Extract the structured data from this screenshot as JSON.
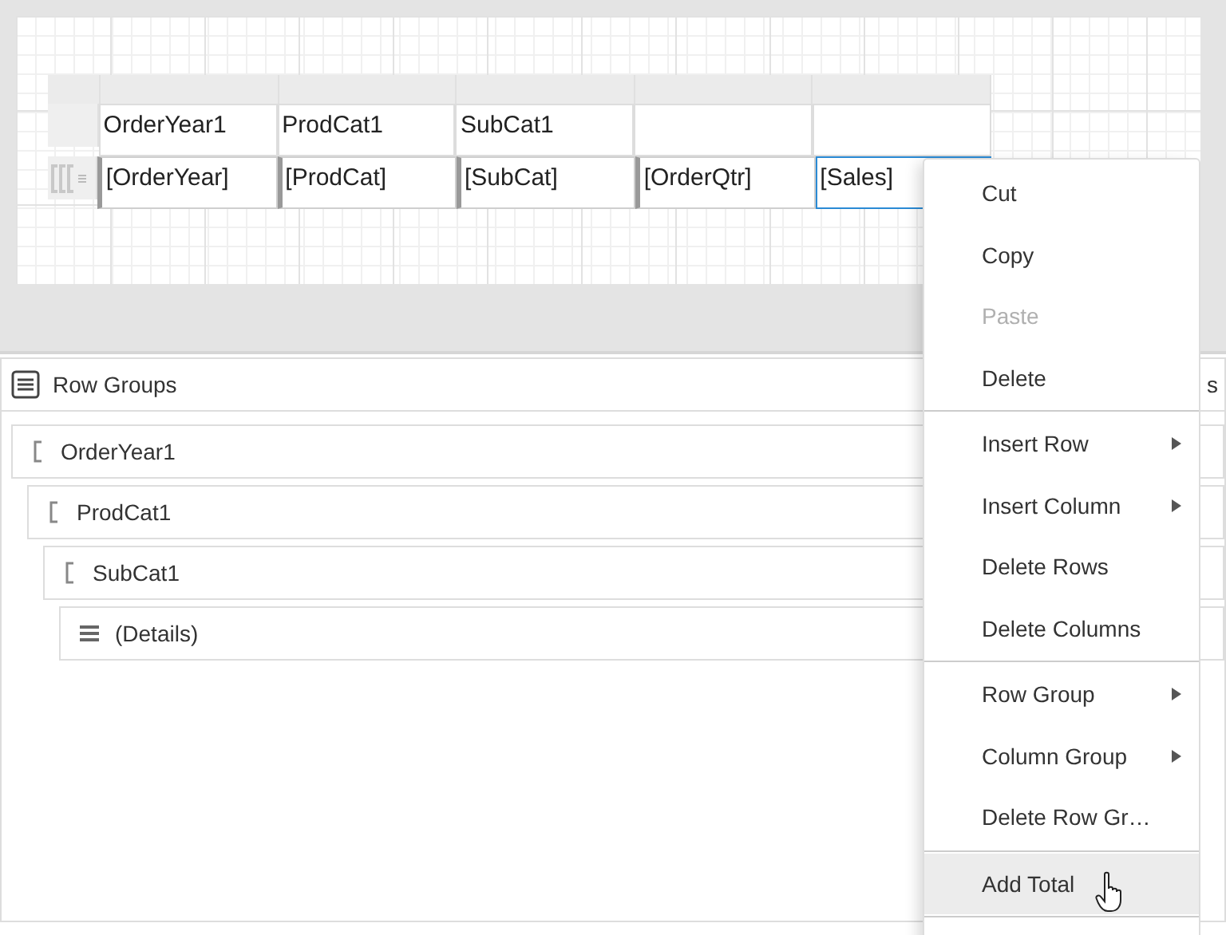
{
  "designer": {
    "table": {
      "group_row": [
        "OrderYear1",
        "ProdCat1",
        "SubCat1"
      ],
      "detail_row": [
        {
          "text": "[OrderYear]",
          "grouped": true,
          "selected": false
        },
        {
          "text": "[ProdCat]",
          "grouped": true,
          "selected": false
        },
        {
          "text": "[SubCat]",
          "grouped": true,
          "selected": false
        },
        {
          "text": "[OrderQtr]",
          "grouped": true,
          "selected": false
        },
        {
          "text": "[Sales]",
          "grouped": false,
          "selected": true
        }
      ]
    }
  },
  "row_groups_panel": {
    "title": "Row Groups",
    "side_panel_title": "s",
    "groups": [
      {
        "name": "OrderYear1",
        "kind": "group",
        "children": [
          {
            "name": "ProdCat1",
            "kind": "group",
            "children": [
              {
                "name": "SubCat1",
                "kind": "group",
                "children": [
                  {
                    "name": "(Details)",
                    "kind": "details"
                  }
                ]
              }
            ]
          }
        ]
      }
    ]
  },
  "context_menu": {
    "sections": [
      [
        {
          "label": "Cut",
          "disabled": false,
          "submenu": false,
          "hovered": false
        },
        {
          "label": "Copy",
          "disabled": false,
          "submenu": false,
          "hovered": false
        },
        {
          "label": "Paste",
          "disabled": true,
          "submenu": false,
          "hovered": false
        },
        {
          "label": "Delete",
          "disabled": false,
          "submenu": false,
          "hovered": false
        }
      ],
      [
        {
          "label": "Insert Row",
          "disabled": false,
          "submenu": true,
          "hovered": false
        },
        {
          "label": "Insert Column",
          "disabled": false,
          "submenu": true,
          "hovered": false
        },
        {
          "label": "Delete Rows",
          "disabled": false,
          "submenu": false,
          "hovered": false
        },
        {
          "label": "Delete Columns",
          "disabled": false,
          "submenu": false,
          "hovered": false
        }
      ],
      [
        {
          "label": "Row Group",
          "disabled": false,
          "submenu": true,
          "hovered": false
        },
        {
          "label": "Column Group",
          "disabled": false,
          "submenu": true,
          "hovered": false
        },
        {
          "label": "Delete Row Gr…",
          "disabled": false,
          "submenu": false,
          "hovered": false
        }
      ],
      [
        {
          "label": "Add Total",
          "disabled": false,
          "submenu": false,
          "hovered": true
        }
      ]
    ]
  }
}
